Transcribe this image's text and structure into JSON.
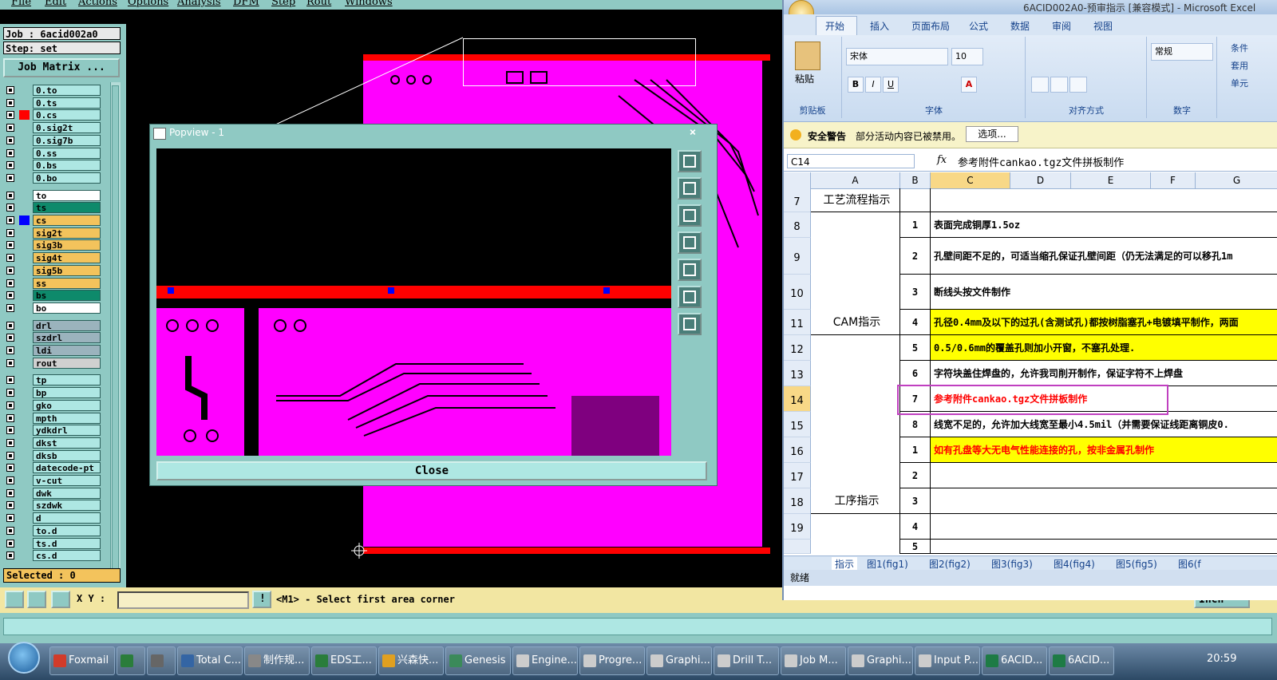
{
  "genesis": {
    "menu": [
      "File",
      "Edit",
      "Actions",
      "Options",
      "Analysis",
      "DFM",
      "Step",
      "Rout",
      "Windows"
    ],
    "job": "Job : 6acid002a0",
    "step": "Step: set",
    "job_matrix": "Job Matrix ...",
    "layers_group1": [
      {
        "name": "0.to",
        "color": ""
      },
      {
        "name": "0.ts",
        "color": ""
      },
      {
        "name": "0.cs",
        "color": "#ff0000"
      },
      {
        "name": "0.sig2t",
        "color": ""
      },
      {
        "name": "0.sig7b",
        "color": ""
      },
      {
        "name": "0.ss",
        "color": ""
      },
      {
        "name": "0.bs",
        "color": ""
      },
      {
        "name": "0.bo",
        "color": ""
      }
    ],
    "layers_group2": [
      {
        "name": "to",
        "bg": "#ffffff",
        "color": ""
      },
      {
        "name": "ts",
        "bg": "#0e8a6b",
        "color": ""
      },
      {
        "name": "cs",
        "bg": "#f3c35c",
        "color": "#0000ff"
      },
      {
        "name": "sig2t",
        "bg": "#f3c35c",
        "color": ""
      },
      {
        "name": "sig3b",
        "bg": "#f3c35c",
        "color": ""
      },
      {
        "name": "sig4t",
        "bg": "#f3c35c",
        "color": ""
      },
      {
        "name": "sig5b",
        "bg": "#f3c35c",
        "color": ""
      },
      {
        "name": "ss",
        "bg": "#f3c35c",
        "color": ""
      },
      {
        "name": "bs",
        "bg": "#0e8a6b",
        "color": ""
      },
      {
        "name": "bo",
        "bg": "#ffffff",
        "color": ""
      }
    ],
    "layers_group3": [
      {
        "name": "drl",
        "bg": "#9bb3bd"
      },
      {
        "name": "szdrl",
        "bg": "#9bb3bd"
      },
      {
        "name": "ldi",
        "bg": "#9bb3bd"
      },
      {
        "name": "rout",
        "bg": "#d0d0d0"
      }
    ],
    "layers_group4": [
      "tp",
      "bp",
      "gko",
      "mpth",
      "ydkdrl",
      "dkst",
      "dksb",
      "datecode-pt",
      "v-cut",
      "dwk",
      "szdwk",
      "d",
      "to.d",
      "ts.d",
      "cs.d"
    ],
    "selected": "Selected : 0",
    "xy_label": "X Y :",
    "xy_value": "",
    "status_msg": "<M1> - Select first area corner",
    "units": "Inch",
    "popview": {
      "title": "Popview - 1",
      "close_x": "×",
      "close_button": "Close"
    },
    "colors": {
      "board": "#ff00ff",
      "strip": "#ff0000",
      "accent": "#8fc9c3"
    }
  },
  "excel": {
    "title": "6ACID002A0-预审指示 [兼容模式] - Microsoft Excel",
    "tabs": [
      "开始",
      "插入",
      "页面布局",
      "公式",
      "数据",
      "审阅",
      "视图"
    ],
    "font_name": "宋体",
    "font_size": "10",
    "number_format": "常规",
    "groups": {
      "clipboard": "剪贴板",
      "font": "字体",
      "align": "对齐方式",
      "number": "数字"
    },
    "paste_label": "粘贴",
    "right_tools": [
      "条件",
      "套用",
      "单元"
    ],
    "security_warning": "安全警告",
    "security_msg": "部分活动内容已被禁用。",
    "options_btn": "选项...",
    "name_box": "C14",
    "fx": "fx",
    "formula": "参考附件cankao.tgz文件拼板制作",
    "columns": [
      "A",
      "B",
      "C",
      "D",
      "E",
      "F",
      "G"
    ],
    "rows": [
      {
        "r": "7",
        "a": "工艺流程指示",
        "b": "",
        "c": ""
      },
      {
        "r": "8",
        "a": "",
        "b": "1",
        "c": "表面完成铜厚1.5oz"
      },
      {
        "r": "9",
        "a": "",
        "b": "2",
        "c": "孔壁间距不足的，可适当缩孔保证孔壁间距（仍无法满足的可以移孔1m"
      },
      {
        "r": "10",
        "a": "",
        "b": "3",
        "c": "断线头按文件制作"
      },
      {
        "r": "11",
        "a": "CAM指示",
        "b": "4",
        "c": "孔径0.4mm及以下的过孔(含测试孔)都按树脂塞孔+电镀填平制作，两面"
      },
      {
        "r": "12",
        "a": "",
        "b": "5",
        "c": "0.5/0.6mm的覆盖孔则加小开窗，不塞孔处理."
      },
      {
        "r": "13",
        "a": "",
        "b": "6",
        "c": "字符块盖住焊盘的，允许我司削开制作，保证字符不上焊盘"
      },
      {
        "r": "14",
        "a": "",
        "b": "7",
        "c": "参考附件cankao.tgz文件拼板制作"
      },
      {
        "r": "15",
        "a": "",
        "b": "8",
        "c": "线宽不足的，允许加大线宽至最小4.5mil（并需要保证线距离铜皮0."
      },
      {
        "r": "16",
        "a": "",
        "b": "1",
        "c": "如有孔盘等大无电气性能连接的孔，按非金属孔制作"
      },
      {
        "r": "17",
        "a": "",
        "b": "2",
        "c": ""
      },
      {
        "r": "18",
        "a": "工序指示",
        "b": "3",
        "c": ""
      },
      {
        "r": "19",
        "a": "",
        "b": "4",
        "c": ""
      },
      {
        "r": "",
        "a": "",
        "b": "5",
        "c": ""
      }
    ],
    "sheet_tabs": [
      "指示",
      "图1(fig1)",
      "图2(fig2)",
      "图3(fig3)",
      "图4(fig4)",
      "图5(fig5)",
      "图6(f"
    ],
    "status": "就绪",
    "highlight_color": "#ffff00",
    "red_text_color": "#ff0000"
  },
  "taskbar": {
    "items": [
      "Foxmail",
      "",
      "",
      "Total C...",
      "制作规...",
      "EDS工...",
      "兴森快...",
      "Genesis",
      "Engine...",
      "Progre...",
      "Graphi...",
      "Drill T...",
      "Job M...",
      "Graphi...",
      "Input P...",
      "6ACID...",
      "6ACID..."
    ],
    "clock": "20:59"
  }
}
